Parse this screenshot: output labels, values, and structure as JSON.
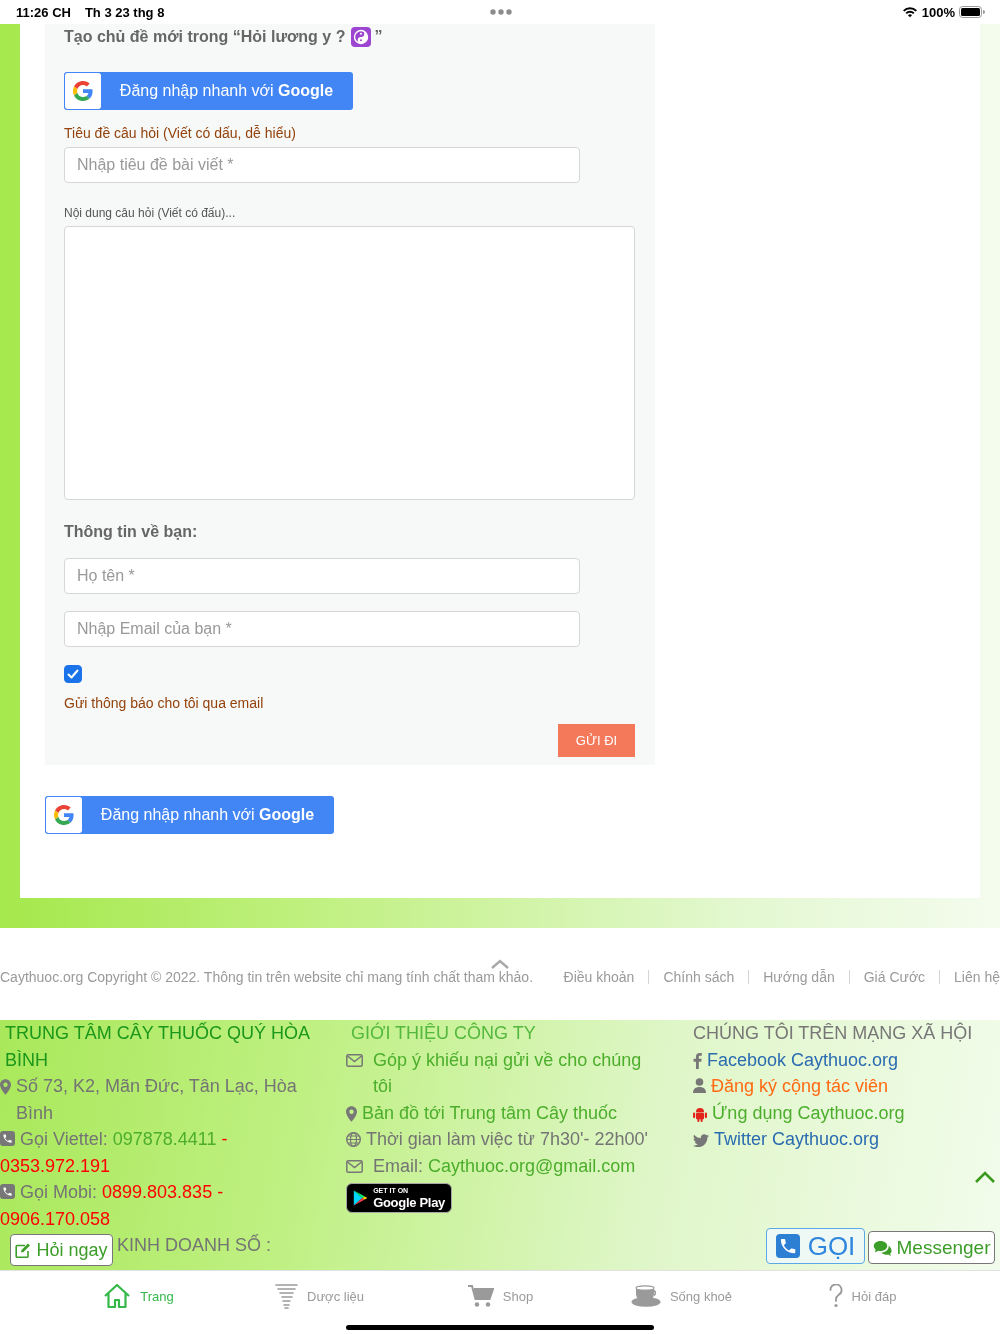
{
  "status_bar": {
    "time": "11:26 CH",
    "date": "Th 3 23 thg 8",
    "battery": "100%"
  },
  "form": {
    "title": "Tạo chủ đề mới trong “Hỏi lương y ?",
    "title_end": "”",
    "google_login": "Đăng nhập nhanh với **Google**",
    "title_label": "Tiêu đề câu hỏi (Viết có dấu, dễ hiểu)",
    "title_field": {
      "placeholder": "Nhập tiêu đề bài viết *"
    },
    "content_label": "Nội dung câu hỏi (Viết có đấu)...",
    "about_heading": "Thông tin về bạn:",
    "fields": [
      {
        "placeholder": "Họ tên *"
      },
      {
        "placeholder": "Nhập Email của bạn *"
      }
    ],
    "notify": {
      "checked": true,
      "label": "Gửi thông báo cho tôi qua email"
    },
    "submit": "GỬI ĐI"
  },
  "google_login": "Đăng nhập nhanh với **Google**",
  "copyright": "Caythuoc.org Copyright © 2022. Thông tin trên website chỉ mang tính chất tham khảo.",
  "footer_links": [
    "Điều khoản",
    "Chính sách",
    "Hướng dẫn",
    "Giá Cước",
    "Liên hệ"
  ],
  "footer": {
    "center": {
      "heading": "TRUNG TÂM CÂY THUỐC QUÝ HÒA BÌNH",
      "address": "Số 73, K2, Mãn Đức, Tân Lạc, Hòa Bình",
      "phones": [
        {
          "label": "Gọi Viettel:",
          "numbers": [
            {
              "text": "097878.4411",
              "color": "#4cae2c"
            },
            {
              "text": "-",
              "color": "#ff0000"
            },
            {
              "text": "0353.972.191",
              "color": "#ff0000"
            }
          ]
        },
        {
          "label": "Gọi Mobi:",
          "numbers": [
            {
              "text": "0899.803.835",
              "color": "#ff0000"
            },
            {
              "text": "-",
              "color": "#ff0000"
            },
            {
              "text": "0906.170.058",
              "color": "#ff0000"
            }
          ]
        }
      ],
      "business_line": "KINH DOANH SỐ :"
    },
    "company": {
      "heading": "GIỚI THIỆU CÔNG TY",
      "items": [
        {
          "kind": "mail",
          "link": "Góp ý khiếu nại gửi về cho chúng tôi"
        },
        {
          "kind": "pin",
          "link": "Bản đồ tới Trung tâm Cây thuốc"
        },
        {
          "kind": "globe",
          "text": "Thời gian làm việc từ 7h30'- 22h00'"
        },
        {
          "kind": "mail",
          "text": "Email:",
          "link": "Caythuoc.org@gmail.com"
        }
      ],
      "store_badge": {
        "small": "GET IT ON",
        "large": "Google Play"
      }
    },
    "social": {
      "heading": "CHÚNG TÔI TRÊN MẠNG XÃ HỘI",
      "items": [
        {
          "kind": "facebook",
          "text": "Facebook Caythuoc.org",
          "color": "#2b6cb0"
        },
        {
          "kind": "user",
          "text": "Đăng ký cộng tác viên",
          "color": "#ff6a13"
        },
        {
          "kind": "android",
          "text": "Ứng dụng Caythuoc.org",
          "color": "#4cae2c"
        },
        {
          "kind": "twitter",
          "text": "Twitter Caythuoc.org",
          "color": "#2b6cb0"
        }
      ]
    }
  },
  "floating": {
    "ask": "Hỏi ngay",
    "call": "GỌI",
    "messenger": "Messenger"
  },
  "tabs": [
    {
      "kind": "home",
      "label": "Trang",
      "selected": true
    },
    {
      "kind": "herb",
      "label": "Dược liệu",
      "selected": false
    },
    {
      "kind": "cart",
      "label": "Shop",
      "selected": false
    },
    {
      "kind": "cup",
      "label": "Sống khoẻ",
      "selected": false
    },
    {
      "kind": "question",
      "label": "Hỏi đáp",
      "selected": false
    }
  ]
}
